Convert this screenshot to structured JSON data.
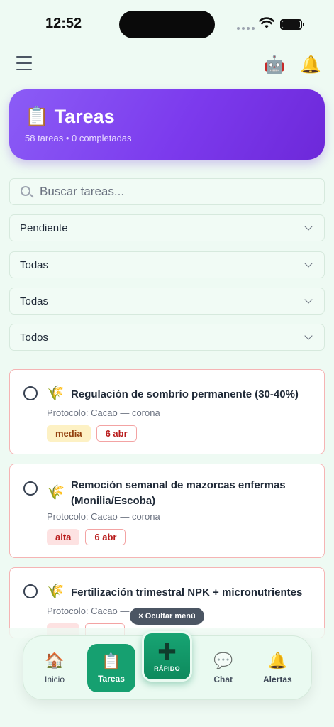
{
  "status_bar": {
    "time": "12:52"
  },
  "header": {
    "menu_icon": "hamburger-icon",
    "robot_icon": "robot-icon",
    "bell_icon": "bell-icon"
  },
  "hero": {
    "icon": "📋",
    "title": "Tareas",
    "subtitle": "58 tareas • 0 completadas",
    "gradient": [
      "#8b5cf6",
      "#6d28d9"
    ]
  },
  "search": {
    "placeholder": "Buscar tareas...",
    "value": ""
  },
  "filters": [
    {
      "label": "Pendiente"
    },
    {
      "label": "Todas"
    },
    {
      "label": "Todas"
    },
    {
      "label": "Todos"
    }
  ],
  "tasks": [
    {
      "icon": "🌾",
      "title": "Regulación de sombrío permanente (30-40%)",
      "protocol": "Protocolo: Cacao — corona",
      "priority": "media",
      "date": "6 abr"
    },
    {
      "icon": "🌾",
      "title": "Remoción semanal de mazorcas enfermas (Monilia/Escoba)",
      "protocol": "Protocolo: Cacao — corona",
      "priority": "alta",
      "date": "6 abr"
    },
    {
      "icon": "🌾",
      "title": "Fertilización trimestral NPK + micronutrientes",
      "protocol": "Protocolo: Cacao —",
      "priority": "",
      "date": ""
    }
  ],
  "hide_menu": "× Ocultar menú",
  "nav": {
    "inicio": {
      "label": "Inicio",
      "icon": "🏠"
    },
    "tareas": {
      "label": "Tareas",
      "icon": "📋"
    },
    "rapido": {
      "label": "RÁPIDO",
      "icon": "✚"
    },
    "chat": {
      "label": "Chat",
      "icon": "💬"
    },
    "alertas": {
      "label": "Alertas",
      "icon": "🔔"
    }
  },
  "colors": {
    "accent": "#16a070",
    "hero": "#7c3aed",
    "card_border": "#f5b4b4"
  }
}
